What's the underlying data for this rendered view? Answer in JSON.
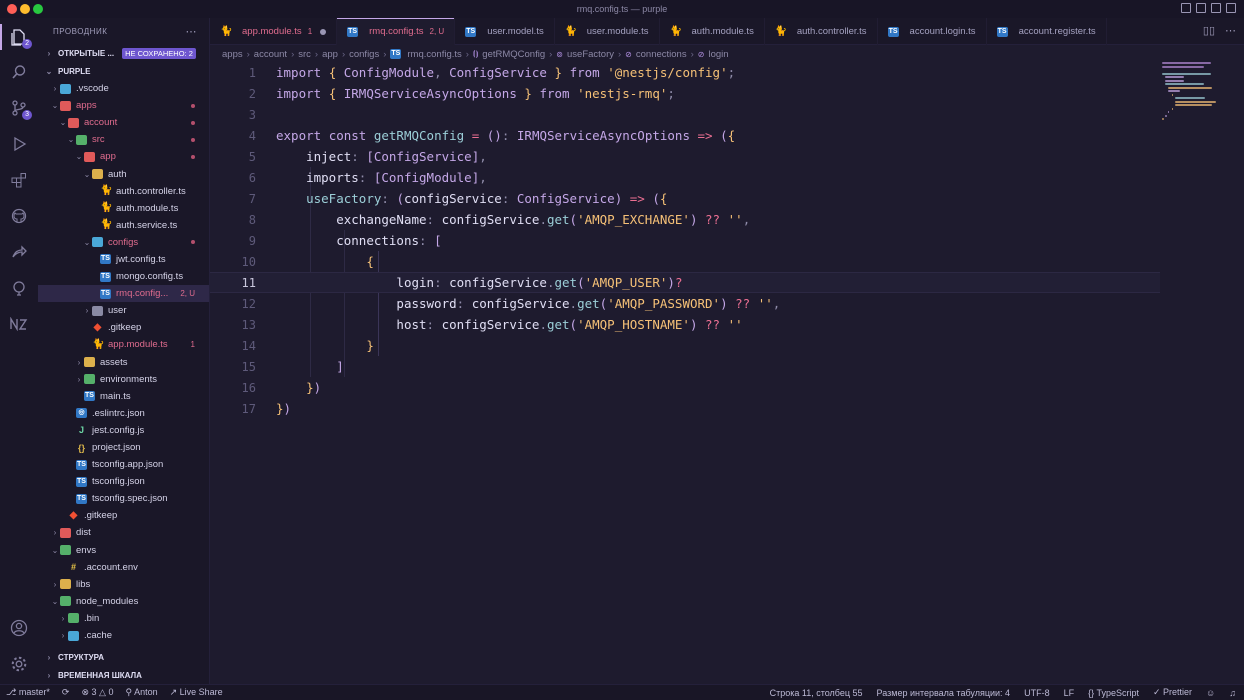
{
  "window": {
    "title": "rmq.config.ts — purple"
  },
  "sidebar": {
    "header": "ПРОВОДНИК",
    "open_editors": {
      "label": "ОТКРЫТЫЕ ...",
      "badge": "НЕ СОХРАНЕНО: 2"
    },
    "root": "PURPLE",
    "tree": [
      {
        "label": ".vscode",
        "depth": 0,
        "kind": "folder-blue",
        "chev": "›",
        "color": "normal"
      },
      {
        "label": "apps",
        "depth": 0,
        "kind": "folder-red",
        "chev": "⌄",
        "color": "red",
        "dot": true
      },
      {
        "label": "account",
        "depth": 1,
        "kind": "folder-red",
        "chev": "⌄",
        "color": "red",
        "dot": true
      },
      {
        "label": "src",
        "depth": 2,
        "kind": "folder-green",
        "chev": "⌄",
        "color": "red",
        "dot": true
      },
      {
        "label": "app",
        "depth": 3,
        "kind": "folder-red",
        "chev": "⌄",
        "color": "red",
        "dot": true
      },
      {
        "label": "auth",
        "depth": 4,
        "kind": "folder",
        "chev": "⌄",
        "color": "normal"
      },
      {
        "label": "auth.controller.ts",
        "depth": 5,
        "kind": "nest-blue",
        "chev": "",
        "color": "normal"
      },
      {
        "label": "auth.module.ts",
        "depth": 5,
        "kind": "nest",
        "chev": "",
        "color": "normal"
      },
      {
        "label": "auth.service.ts",
        "depth": 5,
        "kind": "nest-yellow",
        "chev": "",
        "color": "normal"
      },
      {
        "label": "configs",
        "depth": 4,
        "kind": "folder-blue",
        "chev": "⌄",
        "color": "red",
        "dot": true
      },
      {
        "label": "jwt.config.ts",
        "depth": 5,
        "kind": "ts",
        "chev": "",
        "color": "normal"
      },
      {
        "label": "mongo.config.ts",
        "depth": 5,
        "kind": "ts",
        "chev": "",
        "color": "normal"
      },
      {
        "label": "rmq.config...",
        "depth": 5,
        "kind": "ts",
        "chev": "",
        "color": "red",
        "selected": true,
        "badge": "2, U"
      },
      {
        "label": "user",
        "depth": 4,
        "kind": "folder-gray",
        "chev": "›",
        "color": "normal"
      },
      {
        "label": ".gitkeep",
        "depth": 4,
        "kind": "git",
        "chev": "",
        "color": "normal"
      },
      {
        "label": "app.module.ts",
        "depth": 4,
        "kind": "nest",
        "chev": "",
        "color": "red",
        "badge": "1"
      },
      {
        "label": "assets",
        "depth": 3,
        "kind": "folder",
        "chev": "›",
        "color": "normal"
      },
      {
        "label": "environments",
        "depth": 3,
        "kind": "folder-green",
        "chev": "›",
        "color": "normal"
      },
      {
        "label": "main.ts",
        "depth": 3,
        "kind": "ts",
        "chev": "",
        "color": "normal"
      },
      {
        "label": ".eslintrc.json",
        "depth": 2,
        "kind": "eslint",
        "chev": "",
        "color": "normal"
      },
      {
        "label": "jest.config.js",
        "depth": 2,
        "kind": "js",
        "chev": "",
        "color": "normal"
      },
      {
        "label": "project.json",
        "depth": 2,
        "kind": "json",
        "chev": "",
        "color": "normal"
      },
      {
        "label": "tsconfig.app.json",
        "depth": 2,
        "kind": "ts",
        "chev": "",
        "color": "normal"
      },
      {
        "label": "tsconfig.json",
        "depth": 2,
        "kind": "ts",
        "chev": "",
        "color": "normal"
      },
      {
        "label": "tsconfig.spec.json",
        "depth": 2,
        "kind": "ts",
        "chev": "",
        "color": "normal"
      },
      {
        "label": ".gitkeep",
        "depth": 1,
        "kind": "git",
        "chev": "",
        "color": "normal"
      },
      {
        "label": "dist",
        "depth": 0,
        "kind": "folder-red",
        "chev": "›",
        "color": "normal"
      },
      {
        "label": "envs",
        "depth": 0,
        "kind": "folder-green",
        "chev": "⌄",
        "color": "normal"
      },
      {
        "label": ".account.env",
        "depth": 1,
        "kind": "env",
        "chev": "",
        "color": "normal"
      },
      {
        "label": "libs",
        "depth": 0,
        "kind": "folder",
        "chev": "›",
        "color": "normal"
      },
      {
        "label": "node_modules",
        "depth": 0,
        "kind": "folder-green",
        "chev": "⌄",
        "color": "normal"
      },
      {
        "label": ".bin",
        "depth": 1,
        "kind": "folder-green",
        "chev": "›",
        "color": "normal"
      },
      {
        "label": ".cache",
        "depth": 1,
        "kind": "folder-blue",
        "chev": "›",
        "color": "normal"
      }
    ],
    "outline": "СТРУКТУРА",
    "timeline": "ВРЕМЕННАЯ ШКАЛА"
  },
  "tabs": [
    {
      "label": "app.module.ts",
      "extra": "1",
      "icon": "nest",
      "active": false,
      "red": true,
      "dot": true
    },
    {
      "label": "rmq.config.ts",
      "extra": "2, U",
      "icon": "ts",
      "active": true,
      "red": true,
      "dot": false
    },
    {
      "label": "user.model.ts",
      "extra": "",
      "icon": "ts",
      "active": false,
      "red": false
    },
    {
      "label": "user.module.ts",
      "extra": "",
      "icon": "nest",
      "active": false,
      "red": false
    },
    {
      "label": "auth.module.ts",
      "extra": "",
      "icon": "nest",
      "active": false,
      "red": false
    },
    {
      "label": "auth.controller.ts",
      "extra": "",
      "icon": "nest-blue",
      "active": false,
      "red": false
    },
    {
      "label": "account.login.ts",
      "extra": "",
      "icon": "ts",
      "active": false,
      "red": false
    },
    {
      "label": "account.register.ts",
      "extra": "",
      "icon": "ts",
      "active": false,
      "red": false
    }
  ],
  "breadcrumb": [
    "apps",
    "account",
    "src",
    "app",
    "configs",
    "rmq.config.ts",
    "getRMQConfig",
    "useFactory",
    "connections",
    "login"
  ],
  "editor": {
    "current_line": 11,
    "lines": [
      "import { ConfigModule, ConfigService } from '@nestjs/config';",
      "import { IRMQServiceAsyncOptions } from 'nestjs-rmq';",
      "",
      "export const getRMQConfig = (): IRMQServiceAsyncOptions => ({",
      "    inject: [ConfigService],",
      "    imports: [ConfigModule],",
      "    useFactory: (configService: ConfigService) => ({",
      "        exchangeName: configService.get('AMQP_EXCHANGE') ?? '',",
      "        connections: [",
      "            {",
      "                login: configService.get('AMQP_USER')?",
      "                password: configService.get('AMQP_PASSWORD') ?? '',",
      "                host: configService.get('AMQP_HOSTNAME') ?? ''",
      "            }",
      "        ]",
      "    })",
      "})"
    ]
  },
  "statusbar": {
    "branch": "master*",
    "errors": "3",
    "warnings": "0",
    "user": "Anton",
    "live_share": "Live Share",
    "position": "Строка 11, столбец 55",
    "indent": "Размер интервала табуляции: 4",
    "encoding": "UTF-8",
    "eol": "LF",
    "language": "TypeScript",
    "prettier": "Prettier"
  },
  "colors": {
    "accent": "#c4a7e7",
    "badge": "#6e56cf",
    "modified": "#e06c8e",
    "background": "#1e1b2e"
  }
}
